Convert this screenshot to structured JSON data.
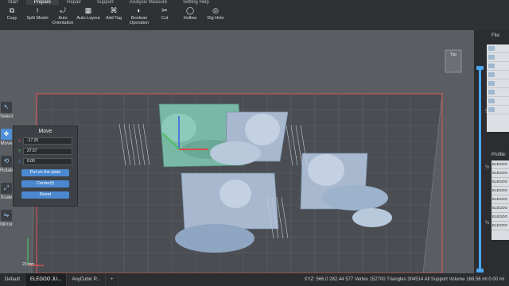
{
  "menu": {
    "tabs": [
      {
        "label": "Start"
      },
      {
        "label": "Prepare",
        "active": true
      },
      {
        "label": "Repair"
      },
      {
        "label": "Support"
      },
      {
        "label": "Analysis Measure"
      },
      {
        "label": "Setting Help"
      }
    ]
  },
  "toolbar": {
    "items": [
      {
        "label": "Copy",
        "icon": "copy-icon"
      },
      {
        "label": "Split Model",
        "icon": "split-icon"
      },
      {
        "label": "Auto Orientation",
        "icon": "orientation-icon"
      },
      {
        "label": "Auto Layout",
        "icon": "layout-icon"
      },
      {
        "label": "Add Tag",
        "icon": "tag-icon"
      },
      {
        "label": "Boolean Operation",
        "icon": "boolean-icon"
      },
      {
        "label": "Cut",
        "icon": "cut-icon"
      },
      {
        "label": "Hollow",
        "icon": "hollow-icon"
      },
      {
        "label": "Dig Hole",
        "icon": "dig-hole-icon"
      }
    ]
  },
  "left_tools": {
    "items": [
      {
        "label": "Select"
      },
      {
        "label": "Move"
      },
      {
        "label": "Rotate"
      },
      {
        "label": "Scale"
      },
      {
        "label": "Mirror"
      }
    ]
  },
  "move_panel": {
    "title": "Move",
    "x": "-17.20",
    "y": "27.57",
    "z": "0.00",
    "put_on_plate_label": "Put on the plate",
    "center_label": "Center(t)",
    "reset_label": "Reset"
  },
  "viewport": {
    "scale_label": "20 mm",
    "view_cube_label": "Top"
  },
  "right_panel": {
    "file_label": "File:",
    "profile_label": "Profile:",
    "slider_marks": [
      "¼",
      "½",
      "¼"
    ],
    "profiles": [
      "ELEGOO",
      "ELEGOO",
      "ELEGOO",
      "ELEGOO",
      "ELEGOO",
      "ELEGOO",
      "ELEGOO",
      "ELEGOO"
    ]
  },
  "bottom_bar": {
    "tabs": [
      "Default",
      "ELEGOO JU...",
      "AnyCubic P...",
      "+"
    ],
    "status_text": "XYZ: 566.0 282.44 577  Vertex 152700  Triangles 304514  All Support Volume 168.56 ml 0.00 ml"
  },
  "colors": {
    "accent": "#4aa6ef",
    "toolbar_bg": "#2f3135",
    "viewport_bg": "#5a5d61",
    "plate_grid": "#4a4d52",
    "plate_border": "#e25656",
    "model_selected": "#79b8a4",
    "model": "#a8b9cf"
  }
}
